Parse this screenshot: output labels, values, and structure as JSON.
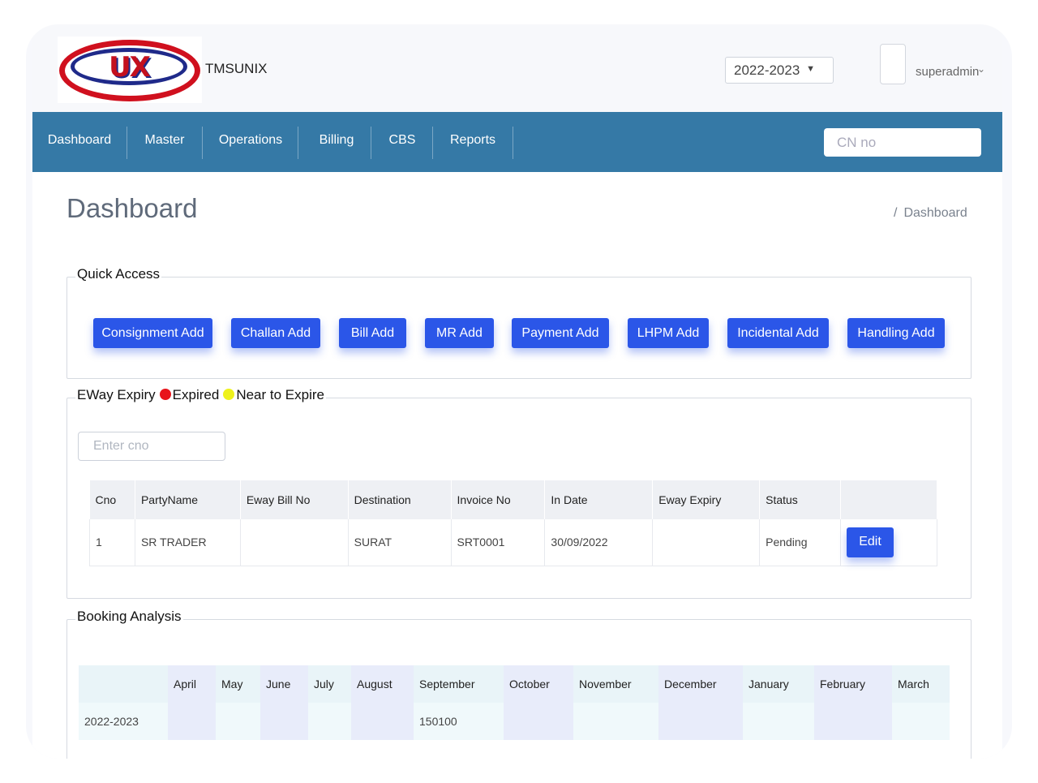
{
  "header": {
    "brand": "TMSUNIX",
    "logo_text": "UX",
    "year_selected": "2022-2023",
    "user_name": "superadmin"
  },
  "nav": {
    "items": [
      "Dashboard",
      "Master",
      "Operations",
      "Billing",
      "CBS",
      "Reports"
    ],
    "cn_placeholder": "CN no"
  },
  "page": {
    "title": "Dashboard",
    "breadcrumb_separator": "/",
    "breadcrumb_current": "Dashboard"
  },
  "quick_access": {
    "legend": "Quick Access",
    "buttons": [
      "Consignment Add",
      "Challan Add",
      "Bill Add",
      "MR Add",
      "Payment Add",
      "LHPM Add",
      "Incidental Add",
      "Handling Add"
    ]
  },
  "eway": {
    "legend": "EWay Expiry",
    "expired_label": "Expired",
    "near_label": "Near to Expire",
    "expired_color": "#e8141b",
    "near_color": "#eef21c",
    "search_placeholder": "Enter cno",
    "columns": [
      "Cno",
      "PartyName",
      "Eway Bill No",
      "Destination",
      "Invoice No",
      "In Date",
      "Eway Expiry",
      "Status",
      ""
    ],
    "rows": [
      {
        "cno": "1",
        "party": "SR TRADER",
        "eway_bill": "",
        "destination": "SURAT",
        "invoice": "SRT0001",
        "in_date": "30/09/2022",
        "expiry": "",
        "status": "Pending",
        "action": "Edit"
      }
    ]
  },
  "booking": {
    "legend": "Booking Analysis",
    "months": [
      "April",
      "May",
      "June",
      "July",
      "August",
      "September",
      "October",
      "November",
      "December",
      "January",
      "February",
      "March"
    ],
    "rows": [
      {
        "year": "2022-2023",
        "values": [
          "",
          "",
          "",
          "",
          "",
          "150100",
          "",
          "",
          "",
          "",
          "",
          ""
        ]
      }
    ]
  },
  "colors": {
    "nav_bg": "#3579a6",
    "button_bg": "#2b56e8"
  }
}
